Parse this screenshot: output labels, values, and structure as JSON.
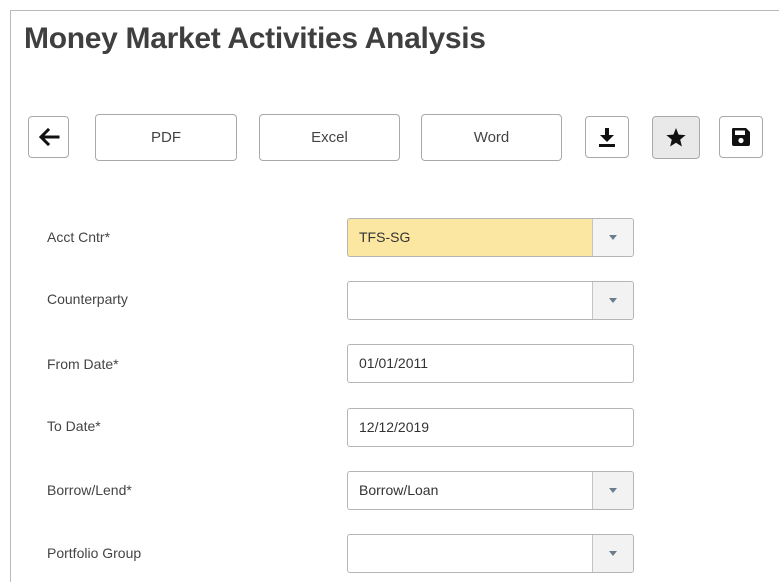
{
  "page": {
    "title": "Money Market Activities Analysis"
  },
  "toolbar": {
    "back_icon": "arrow-left-icon",
    "pdf_label": "PDF",
    "excel_label": "Excel",
    "word_label": "Word",
    "download_icon": "download-icon",
    "star_icon": "star-icon",
    "save_icon": "floppy-disk-icon"
  },
  "form": {
    "acct_cntr": {
      "label": "Acct Cntr*",
      "value": "TFS-SG",
      "highlight_color": "#fbe7a1"
    },
    "counterparty": {
      "label": "Counterparty",
      "value": ""
    },
    "from_date": {
      "label": "From Date*",
      "value": "01/01/2011"
    },
    "to_date": {
      "label": "To Date*",
      "value": "12/12/2019"
    },
    "borrow_lend": {
      "label": "Borrow/Lend*",
      "value": "Borrow/Loan"
    },
    "portfolio_group": {
      "label": "Portfolio Group",
      "value": ""
    }
  }
}
